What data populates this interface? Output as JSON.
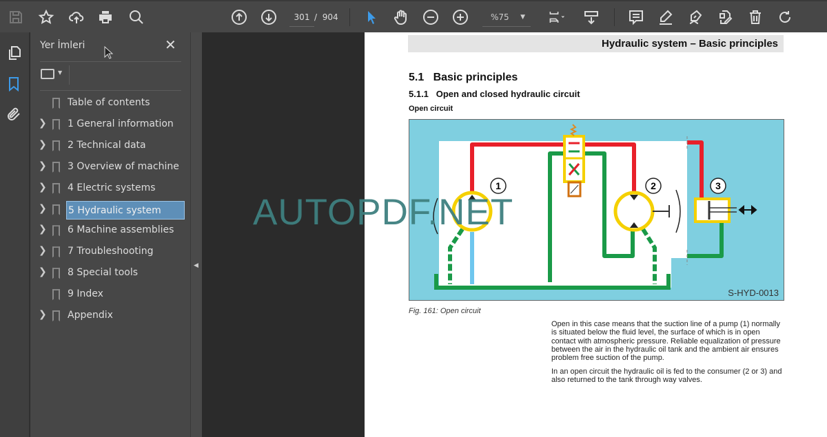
{
  "toolbar": {
    "page_current": "301",
    "page_separator": "/",
    "page_total": "904",
    "zoom": "%75",
    "icons": [
      "save-icon",
      "star-icon",
      "cloud-upload-icon",
      "print-icon",
      "find-icon",
      "page-up-icon",
      "page-down-icon",
      "select-cursor-icon",
      "hand-icon",
      "zoom-out-icon",
      "zoom-in-icon",
      "fit-page-icon",
      "scroll-mode-icon",
      "comment-icon",
      "highlight-icon",
      "sign-icon",
      "edit-pdf-icon",
      "delete-icon",
      "rotate-icon"
    ]
  },
  "sidebar": {
    "title": "Yer İmleri",
    "items": [
      {
        "label": "Table of contents",
        "expandable": false
      },
      {
        "label": "1 General information",
        "expandable": true
      },
      {
        "label": "2 Technical data",
        "expandable": true
      },
      {
        "label": "3 Overview of machine",
        "expandable": true
      },
      {
        "label": "4 Electric systems",
        "expandable": true
      },
      {
        "label": "5 Hydraulic system",
        "expandable": true,
        "selected": true
      },
      {
        "label": "6 Machine assemblies",
        "expandable": true
      },
      {
        "label": "7 Troubleshooting",
        "expandable": true
      },
      {
        "label": "8 Special tools",
        "expandable": true
      },
      {
        "label": "9 Index",
        "expandable": false
      },
      {
        "label": "Appendix",
        "expandable": true
      }
    ]
  },
  "document": {
    "running_header": "Hydraulic system – Basic principles",
    "section": "5.1   Basic principles",
    "subsection": "5.1.1   Open and closed hydraulic circuit",
    "subheading": "Open circuit",
    "figure": {
      "labels": [
        "1",
        "2",
        "3"
      ],
      "code": "S-HYD-0013",
      "caption": "Fig.  161: Open circuit",
      "colors": {
        "pressure": "#e8202a",
        "return": "#1a9a48",
        "suction": "#6ec6ee",
        "background": "#7fcfe0",
        "component": "#f5d000"
      }
    },
    "paragraphs": [
      "Open in this case means that the suction line of a pump (1) normally is situated below the fluid level, the surface of which is in open contact with atmospheric pressure. Reliable equalization of pressure between the air in the hydraulic oil tank and the ambient air ensures problem free suction of the pump.",
      "In an open circuit the hydraulic oil is fed to the consumer (2 or 3) and also returned to the tank through way valves."
    ]
  },
  "watermark": "AUTOPDF.NET"
}
